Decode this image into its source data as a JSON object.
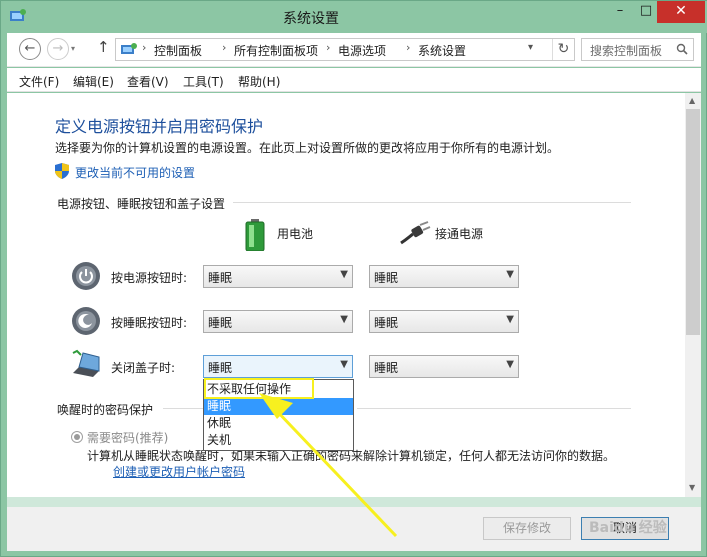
{
  "window": {
    "title": "系统设置",
    "min": "–",
    "max": "□",
    "close": "✕"
  },
  "nav": {
    "back": "←",
    "forward": "→",
    "up": "↑",
    "recent": "▾",
    "breadcrumbs": [
      "控制面板",
      "所有控制面板项",
      "电源选项",
      "系统设置"
    ],
    "sep": "›",
    "dropdown": "▾",
    "refresh": "↻",
    "search_placeholder": "搜索控制面板"
  },
  "menu": [
    "文件(F)",
    "编辑(E)",
    "查看(V)",
    "工具(T)",
    "帮助(H)"
  ],
  "page": {
    "heading": "定义电源按钮并启用密码保护",
    "description": "选择要为你的计算机设置的电源设置。在此页上对设置所做的更改将应用于你所有的电源计划。",
    "change_link": "更改当前不可用的设置",
    "section_buttons": "电源按钮、睡眠按钮和盖子设置",
    "col_battery": "用电池",
    "col_plugged": "接通电源",
    "rows": [
      {
        "label": "按电源按钮时:",
        "battery": "睡眠",
        "plugged": "睡眠"
      },
      {
        "label": "按睡眠按钮时:",
        "battery": "睡眠",
        "plugged": "睡眠"
      },
      {
        "label": "关闭盖子时:",
        "battery": "睡眠",
        "plugged": "睡眠"
      }
    ],
    "dropdown_options": [
      "不采取任何操作",
      "睡眠",
      "休眠",
      "关机"
    ],
    "section_password": "唤醒时的密码保护",
    "radio_require": "需要密码(推荐)",
    "password_desc": "计算机从睡眠状态唤醒时，如果未输入正确的密码来解除计算机锁定，任何人都无法访问你的数据。",
    "password_link": "创建或更改用户帐户密码"
  },
  "footer": {
    "save": "保存修改",
    "cancel": "取消"
  },
  "watermark": "Baidu 经验",
  "colors": {
    "accent_blue": "#1d5fb5",
    "selection": "#3399ff",
    "highlight": "#f7f01f",
    "close_red": "#c7302a"
  }
}
